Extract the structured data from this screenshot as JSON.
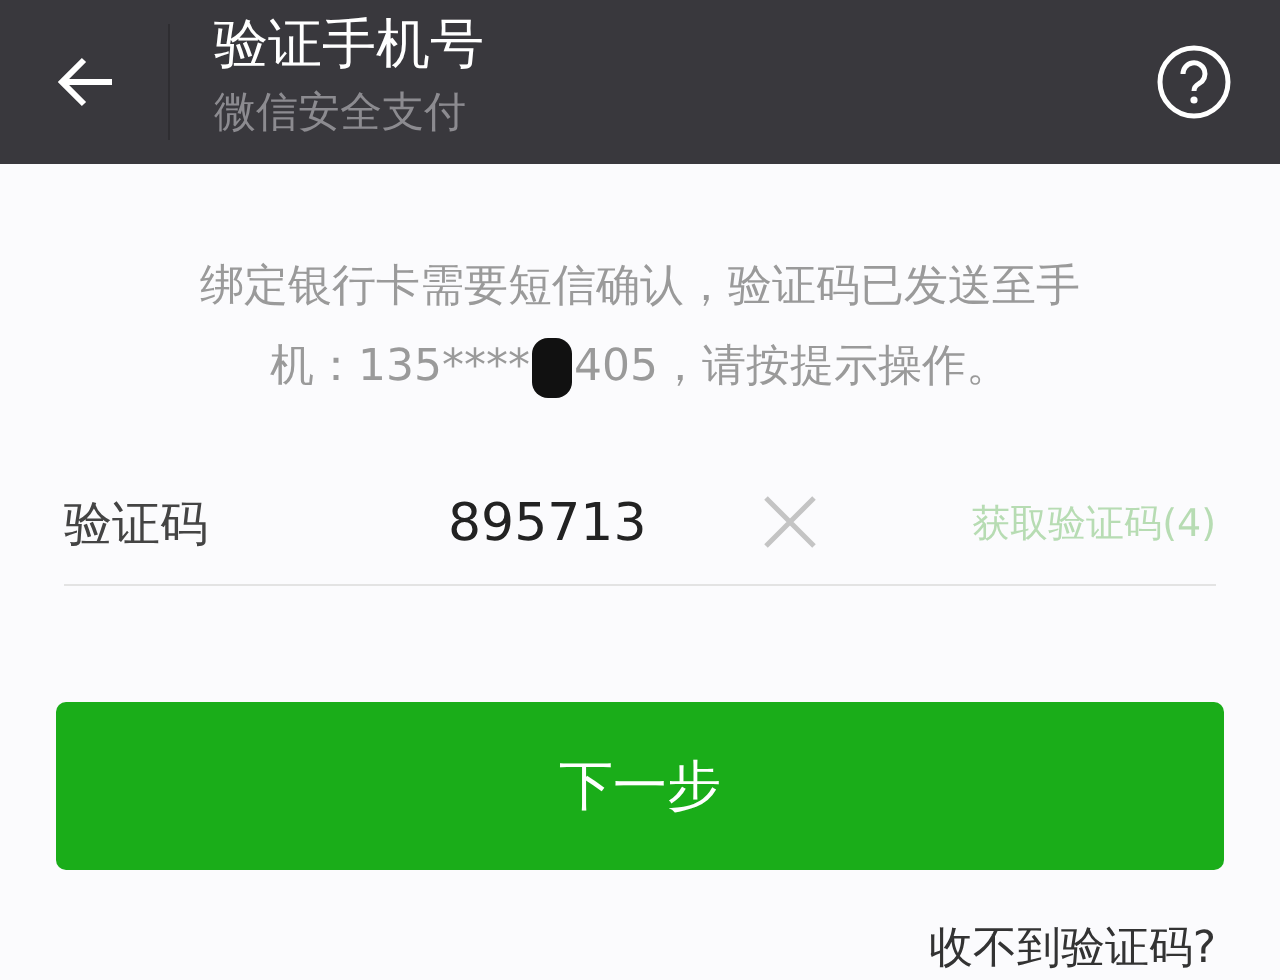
{
  "header": {
    "title": "验证手机号",
    "subtitle": "微信安全支付"
  },
  "prompt": {
    "line_1": "绑定银行卡需要短信确认，验证码已发送至手",
    "before": "机：135****",
    "after": "405，请按提示操作。"
  },
  "code_field": {
    "label": "验证码",
    "value": "895713"
  },
  "resend_button": {
    "label": "获取验证码(4)",
    "disabled": true
  },
  "next_button": {
    "label": "下一步"
  },
  "help_link": {
    "label": "收不到验证码?"
  }
}
